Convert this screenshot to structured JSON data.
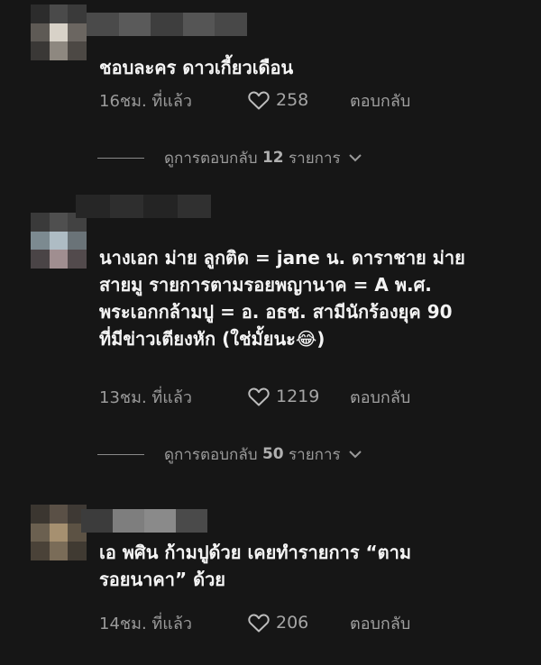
{
  "comments": [
    {
      "text": "ชอบละคร ดาวเกี้ยวเดือน",
      "time": "16ชม. ที่แล้ว",
      "likes": "258",
      "reply_label": "ตอบกลับ",
      "view_replies": {
        "prefix": "ดูการตอบกลับ",
        "count": "12",
        "suffix": "รายการ"
      }
    },
    {
      "text": "นางเอก ม่าย ลูกติด = jane น. ดาราชาย ม่าย\nสายมู รายการตามรอยพญานาค = A พ.ศ.\nพระเอกกล้ามปู = อ. อธช. สามีนักร้องยุค 90\nที่มีข่าวเตียงหัก (ใช่มั้ยนะ😂)",
      "time": "13ชม. ที่แล้ว",
      "likes": "1219",
      "reply_label": "ตอบกลับ",
      "view_replies": {
        "prefix": "ดูการตอบกลับ",
        "count": "50",
        "suffix": "รายการ"
      }
    },
    {
      "text": "เอ พศิน ก้ามปูด้วย เคยทำรายการ “ตาม\nรอยนาคา” ด้วย",
      "time": "14ชม. ที่แล้ว",
      "likes": "206",
      "reply_label": "ตอบกลับ"
    }
  ],
  "icons": {
    "like": "heart-outline-icon",
    "expand": "chevron-down-icon"
  },
  "colors": {
    "background": "#161616",
    "text": "#f4f4f4",
    "muted": "#9a9a9a"
  }
}
